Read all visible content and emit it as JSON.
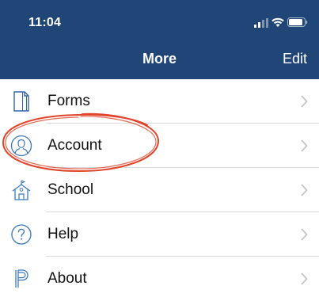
{
  "status_bar": {
    "time": "11:04"
  },
  "nav": {
    "title": "More",
    "edit_label": "Edit"
  },
  "menu": {
    "items": [
      {
        "label": "Forms",
        "icon": "document-icon"
      },
      {
        "label": "Account",
        "icon": "person-icon"
      },
      {
        "label": "School",
        "icon": "schoolhouse-icon"
      },
      {
        "label": "Help",
        "icon": "question-icon"
      },
      {
        "label": "About",
        "icon": "p-logo-icon"
      }
    ]
  },
  "colors": {
    "header_bg": "#1f4677",
    "accent_icon": "#3b78c2",
    "annotation": "#e0452b"
  }
}
